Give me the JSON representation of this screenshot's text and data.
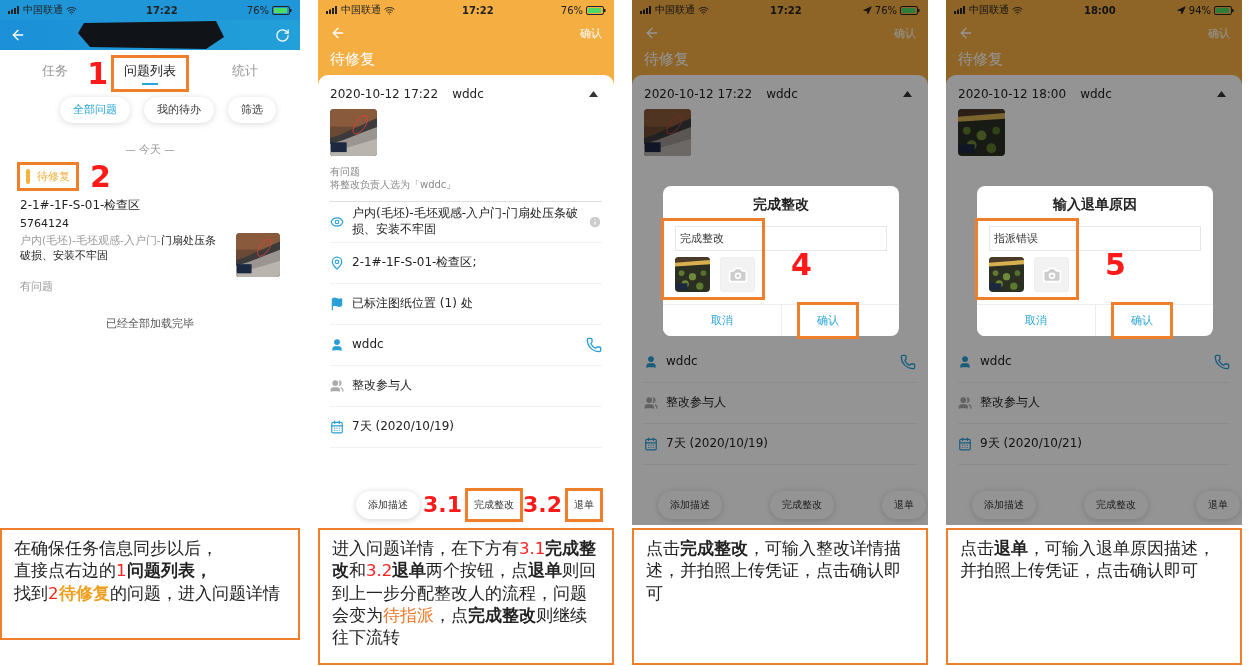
{
  "panels": [
    {
      "kind": "list",
      "status_bar": {
        "carrier": "中国联通",
        "time": "17:22",
        "battery": "76%",
        "location": false
      },
      "tabs": [
        {
          "label": "任务",
          "selected": false,
          "highlighted": false
        },
        {
          "label": "问题列表",
          "selected": true,
          "highlighted": true,
          "callout": "1"
        },
        {
          "label": "统计",
          "selected": false,
          "highlighted": false
        }
      ],
      "filters": [
        {
          "label": "全部问题",
          "selected": true
        },
        {
          "label": "我的待办",
          "selected": false
        },
        {
          "label": "筛选",
          "selected": false
        }
      ],
      "day_divider": "— 今天 —",
      "issues": [
        {
          "status": "待修复",
          "highlighted": true,
          "callout": "2",
          "location": "2-1#-1F-S-01-检查区",
          "code": "5764124",
          "description": "户内(毛坯)-毛坯观感-入户门-**门扇处压条破损、安装不牢固**",
          "note": "有问题",
          "photo": {
            "kind": "picture"
          }
        }
      ],
      "footer": "已经全部加载完毕",
      "caption": [
        [
          {
            "text": "在确保任务信息同步以后，"
          }
        ],
        [
          {
            "text": "直接点右边的"
          },
          {
            "text": "1",
            "color": "#ff2020"
          },
          {
            "text": "问题列表，",
            "bold": true
          }
        ],
        [
          {
            "text": "找到"
          },
          {
            "text": "2",
            "color": "#ff2020"
          },
          {
            "text": "待修复",
            "bold": true,
            "color": "#f0a020"
          },
          {
            "text": "的问题，进入问题详情"
          }
        ]
      ]
    },
    {
      "kind": "detail",
      "status_bar": {
        "carrier": "中国联通",
        "time": "17:22",
        "battery": "76%",
        "location": false
      },
      "nav": {
        "confirm": "确认",
        "title": "待修复"
      },
      "record": {
        "datetime": "2020-10-12 17:22",
        "user": "wddc",
        "photo": {
          "kind": "picture"
        },
        "notes": [
          "有问题",
          "将整改负责人选为「wddc」"
        ]
      },
      "rows": [
        {
          "kind": "issue",
          "text": "户内(毛坯)-毛坯观感-入户门-门扇处压条破损、安装不牢固"
        },
        {
          "kind": "location",
          "text": "2-1#-1F-S-01-检查区;"
        },
        {
          "kind": "marker",
          "text": "已标注图纸位置 (1) 处"
        },
        {
          "kind": "assignee",
          "text": "wddc"
        },
        {
          "kind": "participants",
          "text": "整改参与人"
        },
        {
          "kind": "deadline",
          "text": "7天 (2020/10/19)"
        }
      ],
      "actions": [
        {
          "label": "添加描述",
          "highlighted": false
        },
        {
          "label": "完成整改",
          "highlighted": true,
          "callout": "3.1"
        },
        {
          "label": "退单",
          "highlighted": true,
          "callout": "3.2"
        }
      ],
      "caption": [
        [
          {
            "text": "进入问题详情，在下方有"
          },
          {
            "text": "3.1",
            "color": "#ff2020"
          },
          {
            "text": "完成整改",
            "bold": true
          },
          {
            "text": "和"
          },
          {
            "text": "3.2",
            "color": "#ff2020"
          },
          {
            "text": "退单",
            "bold": true
          },
          {
            "text": "两个按钮，点"
          },
          {
            "text": "退单",
            "bold": true
          },
          {
            "text": "则回到上一步分配整改人的流程，问题会变为"
          },
          {
            "text": "待指派",
            "color": "#f07a2a"
          },
          {
            "text": "，点"
          },
          {
            "text": "完成整改",
            "bold": true
          },
          {
            "text": "则继续往下流转"
          }
        ]
      ]
    },
    {
      "kind": "detail",
      "status_bar": {
        "carrier": "中国联通",
        "time": "17:22",
        "battery": "76%",
        "location": true
      },
      "nav": {
        "confirm": "确认",
        "title": "待修复"
      },
      "record": {
        "datetime": "2020-10-12 17:22",
        "user": "wddc",
        "photo": {
          "kind": "picture"
        }
      },
      "rows": [
        {
          "kind": "assignee",
          "text": "wddc"
        },
        {
          "kind": "participants",
          "text": "整改参与人"
        },
        {
          "kind": "deadline",
          "text": "7天 (2020/10/19)"
        }
      ],
      "actions": [
        {
          "label": "添加描述",
          "highlighted": false
        },
        {
          "label": "完成整改",
          "highlighted": false
        },
        {
          "label": "退单",
          "highlighted": false
        }
      ],
      "dialog": {
        "title": "完成整改",
        "value": "完成整改",
        "callout": "4",
        "cancel": "取消",
        "confirm": "确认",
        "confirm_highlighted": true
      },
      "caption": [
        [
          {
            "text": "点击"
          },
          {
            "text": "完成整改",
            "bold": true
          },
          {
            "text": "，可输入整改详情描述，并拍照上传凭证，点击确认即可"
          }
        ]
      ]
    },
    {
      "kind": "detail",
      "status_bar": {
        "carrier": "中国联通",
        "time": "18:00",
        "battery": "94%",
        "location": true
      },
      "nav": {
        "confirm": "确认",
        "title": "待修复"
      },
      "record": {
        "datetime": "2020-10-12 18:00",
        "user": "wddc",
        "photo": {
          "kind": "picture"
        }
      },
      "rows": [
        {
          "kind": "assignee",
          "text": "wddc"
        },
        {
          "kind": "participants",
          "text": "整改参与人"
        },
        {
          "kind": "deadline",
          "text": "9天 (2020/10/21)"
        }
      ],
      "actions": [
        {
          "label": "添加描述",
          "highlighted": false
        },
        {
          "label": "完成整改",
          "highlighted": false
        },
        {
          "label": "退单",
          "highlighted": false
        }
      ],
      "dialog": {
        "title": "输入退单原因",
        "value": "指派错误",
        "callout": "5",
        "cancel": "取消",
        "confirm": "确认",
        "confirm_highlighted": true
      },
      "caption": [
        [
          {
            "text": "点击"
          },
          {
            "text": "退单",
            "bold": true
          },
          {
            "text": "，可输入退单原因描述，并拍照上传凭证，点击确认即可"
          }
        ]
      ]
    }
  ]
}
